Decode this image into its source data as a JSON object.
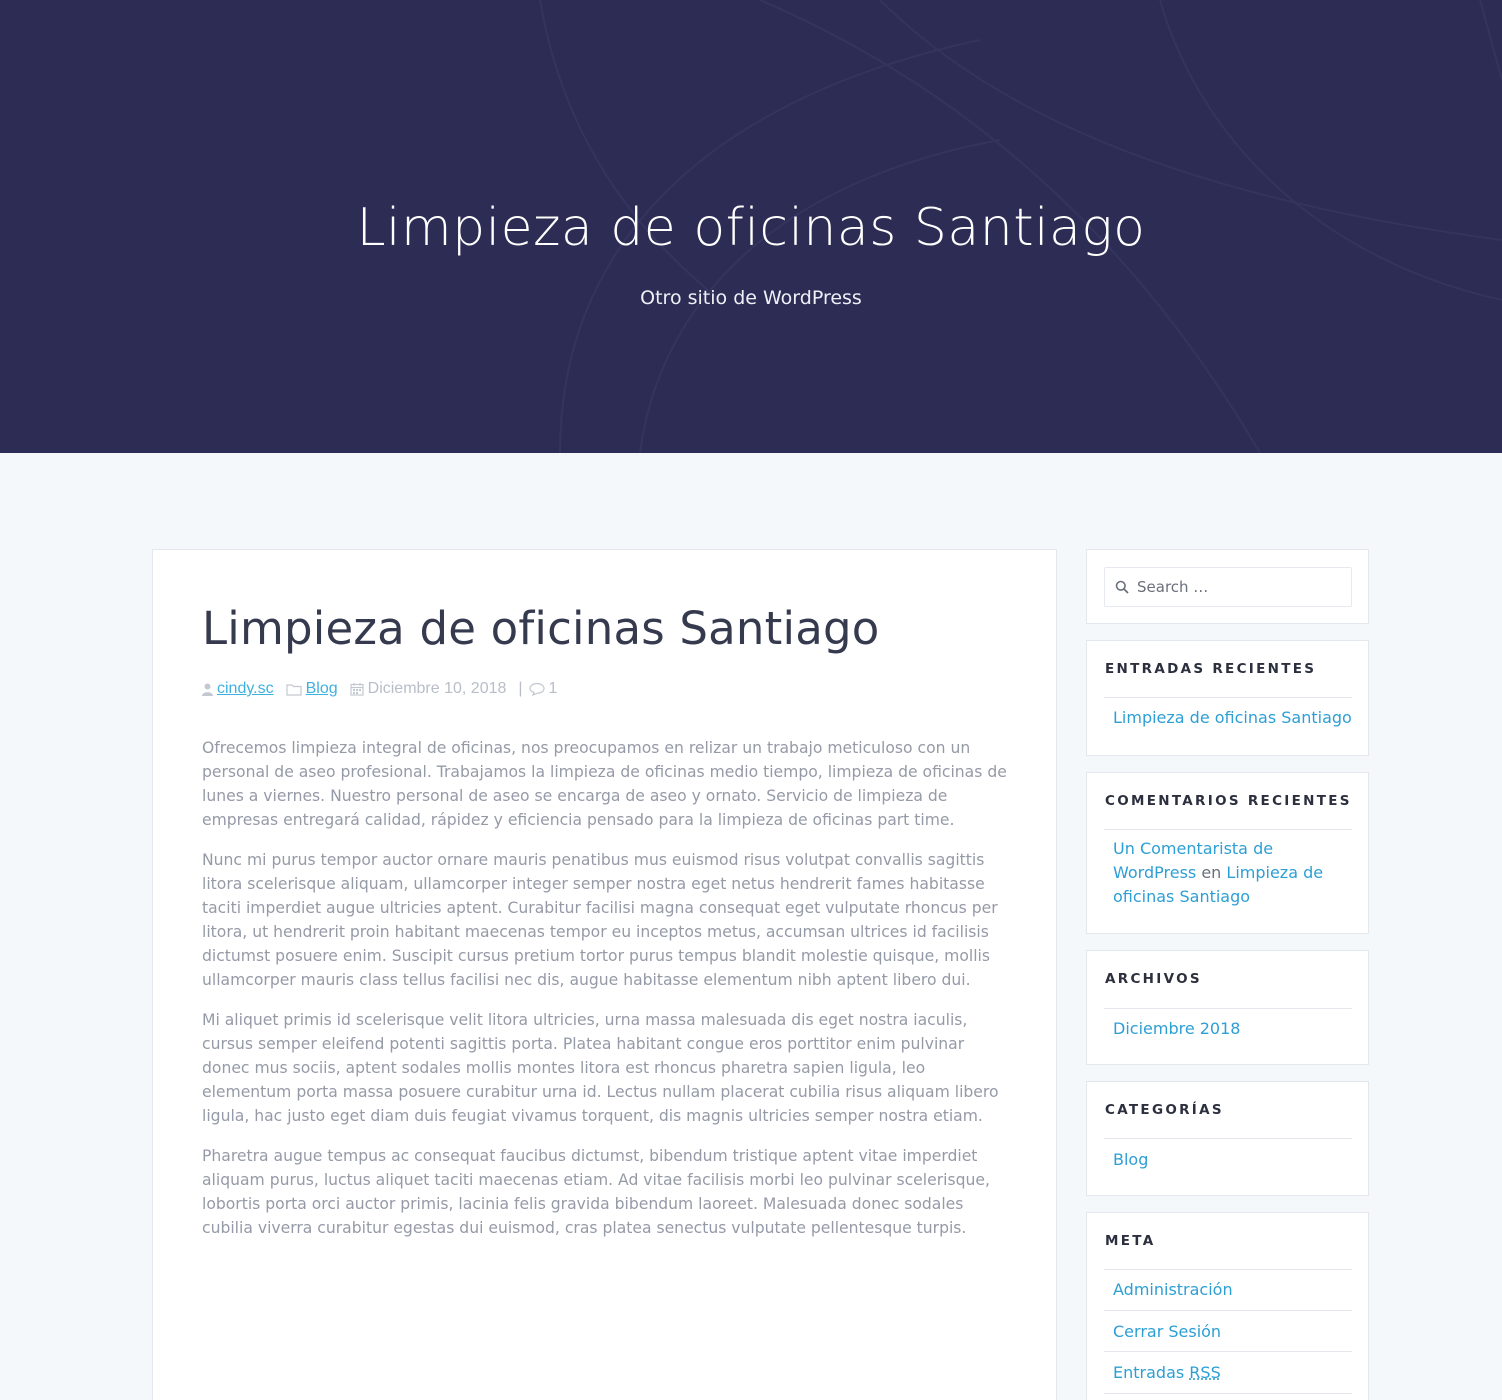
{
  "header": {
    "site_title": "Limpieza de oficinas Santiago",
    "tagline": "Otro sitio de WordPress"
  },
  "post": {
    "title": "Limpieza de oficinas Santiago",
    "meta": {
      "author": "cindy.sc",
      "category": "Blog",
      "date": "Diciembre 10, 2018",
      "separator": "|",
      "comments": "1"
    },
    "paragraphs": [
      "Ofrecemos limpieza integral de oficinas, nos preocupamos en relizar un trabajo meticuloso con un personal de aseo profesional. Trabajamos la limpieza de oficinas medio tiempo, limpieza de oficinas de lunes a viernes. Nuestro personal de aseo se encarga de aseo y ornato. Servicio de limpieza de empresas entregará calidad, rápidez y eficiencia pensado para la limpieza de oficinas part time.",
      "Nunc mi purus tempor auctor ornare mauris penatibus mus euismod risus volutpat convallis sagittis litora scelerisque aliquam, ullamcorper integer semper nostra eget netus hendrerit fames habitasse taciti imperdiet augue ultricies aptent. Curabitur facilisi magna consequat eget vulputate rhoncus per litora, ut hendrerit proin habitant maecenas tempor eu inceptos metus, accumsan ultrices id facilisis dictumst posuere enim. Suscipit cursus pretium tortor purus tempus blandit molestie quisque, mollis ullamcorper mauris class tellus facilisi nec dis, augue habitasse elementum nibh aptent libero dui.",
      "Mi aliquet primis id scelerisque velit litora ultricies, urna massa malesuada dis eget nostra iaculis, cursus semper eleifend potenti sagittis porta. Platea habitant congue eros porttitor enim pulvinar donec mus sociis, aptent sodales mollis montes litora est rhoncus pharetra sapien ligula, leo elementum porta massa posuere curabitur urna id. Lectus nullam placerat cubilia risus aliquam libero ligula, hac justo eget diam duis feugiat vivamus torquent, dis magnis ultricies semper nostra etiam.",
      "Pharetra augue tempus ac consequat faucibus dictumst, bibendum tristique aptent vitae imperdiet aliquam purus, luctus aliquet taciti maecenas etiam. Ad vitae facilisis morbi leo pulvinar scelerisque, lobortis porta orci auctor primis, lacinia felis gravida bibendum laoreet. Malesuada donec sodales cubilia viverra curabitur egestas dui euismod, cras platea senectus vulputate pellentesque turpis."
    ]
  },
  "sidebar": {
    "search": {
      "placeholder": "Search …",
      "icon": "search-icon"
    },
    "recent_posts": {
      "title": "ENTRADAS RECIENTES",
      "items": [
        "Limpieza de oficinas Santiago"
      ]
    },
    "recent_comments": {
      "title": "COMENTARIOS RECIENTES",
      "author": "Un Comentarista de WordPress",
      "connector": "en",
      "post": "Limpieza de oficinas Santiago"
    },
    "archives": {
      "title": "ARCHIVOS",
      "items": [
        "Diciembre 2018"
      ]
    },
    "categories": {
      "title": "CATEGORÍAS",
      "items": [
        "Blog"
      ]
    },
    "meta": {
      "title": "META",
      "items": [
        "Administración",
        "Cerrar Sesión"
      ],
      "rss_prefix": "Entradas",
      "rss_abbr": "RSS"
    }
  },
  "colors": {
    "hero_bg": "#2c2c55",
    "link": "#2d9fd5",
    "meta_link": "#3fb1e0",
    "page_bg": "#f4f8fb"
  }
}
